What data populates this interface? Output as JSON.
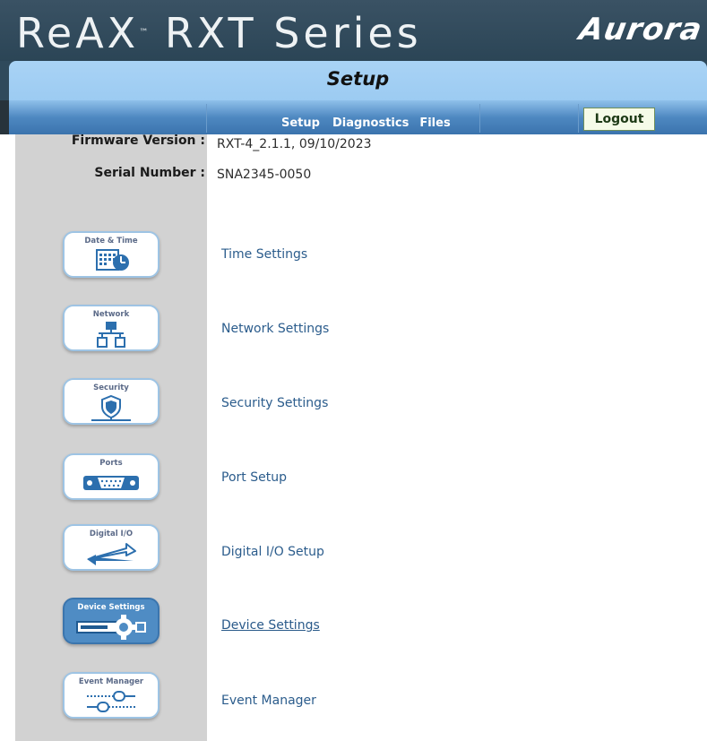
{
  "header": {
    "brand_title": "ReAX",
    "brand_series": "RXT Series",
    "trademark": "™",
    "aurora_logo": "Aurora"
  },
  "page": {
    "title": "Setup"
  },
  "nav": {
    "links": [
      "Setup",
      "Diagnostics",
      "Files"
    ],
    "logout_label": "Logout"
  },
  "info": {
    "firmware_label": "Firmware Version :",
    "firmware_value": "RXT-4_2.1.1, 09/10/2023",
    "serial_label": "Serial Number :",
    "serial_value": "SNA2345-0050"
  },
  "menu": [
    {
      "icon_label": "Date & Time",
      "icon_name": "calendar-clock-icon",
      "link": "Time Settings",
      "active": false
    },
    {
      "icon_label": "Network",
      "icon_name": "network-icon",
      "link": "Network Settings",
      "active": false
    },
    {
      "icon_label": "Security",
      "icon_name": "shield-icon",
      "link": "Security Settings",
      "active": false
    },
    {
      "icon_label": "Ports",
      "icon_name": "serial-port-icon",
      "link": "Port Setup",
      "active": false
    },
    {
      "icon_label": "Digital I/O",
      "icon_name": "digital-io-icon",
      "link": "Digital I/O Setup",
      "active": false
    },
    {
      "icon_label": "Device Settings",
      "icon_name": "device-gear-icon",
      "link": "Device Settings",
      "active": true
    },
    {
      "icon_label": "Event Manager",
      "icon_name": "event-slider-icon",
      "link": "Event Manager",
      "active": false
    }
  ],
  "colors": {
    "banner": "#2f4a5c",
    "title_bar": "#a9d3f5",
    "nav_bar": "#4e88c1",
    "sidebar": "#d2d2d2",
    "link": "#2b5c8c",
    "active_button": "#4f8cc4"
  }
}
